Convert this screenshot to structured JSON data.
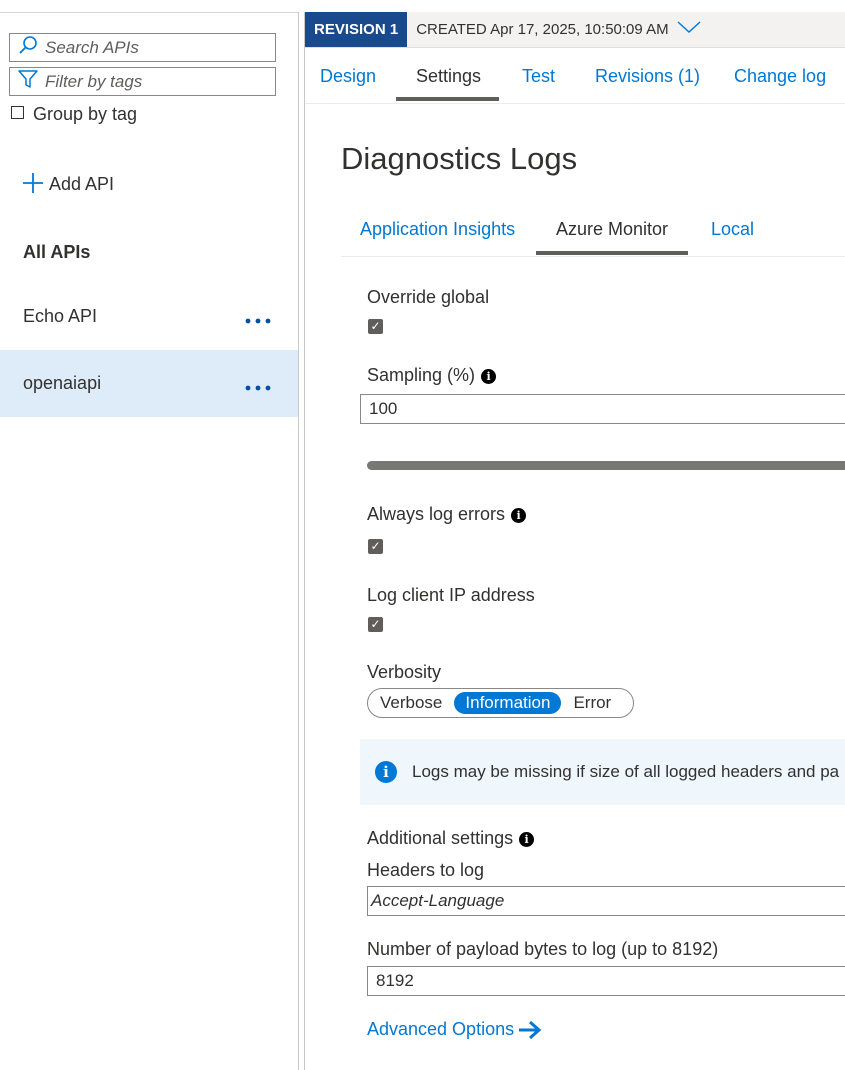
{
  "sidebar": {
    "search_placeholder": "Search APIs",
    "filter_placeholder": "Filter by tags",
    "group_by_tag": "Group by tag",
    "add_api": "Add API",
    "all_apis": "All APIs",
    "apis": [
      {
        "name": "Echo API",
        "more": "..."
      },
      {
        "name": "openaiapi",
        "more": "..."
      }
    ]
  },
  "revision": {
    "badge": "REVISION 1",
    "created": "CREATED Apr 17, 2025, 10:50:09 AM"
  },
  "tabs": [
    "Design",
    "Settings",
    "Test",
    "Revisions (1)",
    "Change log"
  ],
  "active_tab": "Settings",
  "page": {
    "title": "Diagnostics Logs",
    "subtabs": [
      "Application Insights",
      "Azure Monitor",
      "Local"
    ],
    "active_subtab": "Azure Monitor"
  },
  "form": {
    "override_global": {
      "label": "Override global",
      "checked": true
    },
    "sampling": {
      "label": "Sampling (%)",
      "value": "100",
      "slider_value": 100
    },
    "always_log_errors": {
      "label": "Always log errors",
      "checked": true
    },
    "log_client_ip": {
      "label": "Log client IP address",
      "checked": true
    },
    "verbosity": {
      "label": "Verbosity",
      "options": [
        "Verbose",
        "Information",
        "Error"
      ],
      "selected": "Information"
    },
    "info_message": "Logs may be missing if size of all logged headers and pa",
    "additional_settings": "Additional settings",
    "headers_to_log": {
      "label": "Headers to log",
      "value": "Accept-Language"
    },
    "payload_bytes": {
      "label": "Number of payload bytes to log (up to 8192)",
      "value": "8192"
    },
    "advanced_options": "Advanced Options"
  },
  "colors": {
    "accent": "#0078d4",
    "revision_badge": "#194a8d",
    "selected_row": "#deecf9",
    "info_bg": "#eff6fc"
  }
}
